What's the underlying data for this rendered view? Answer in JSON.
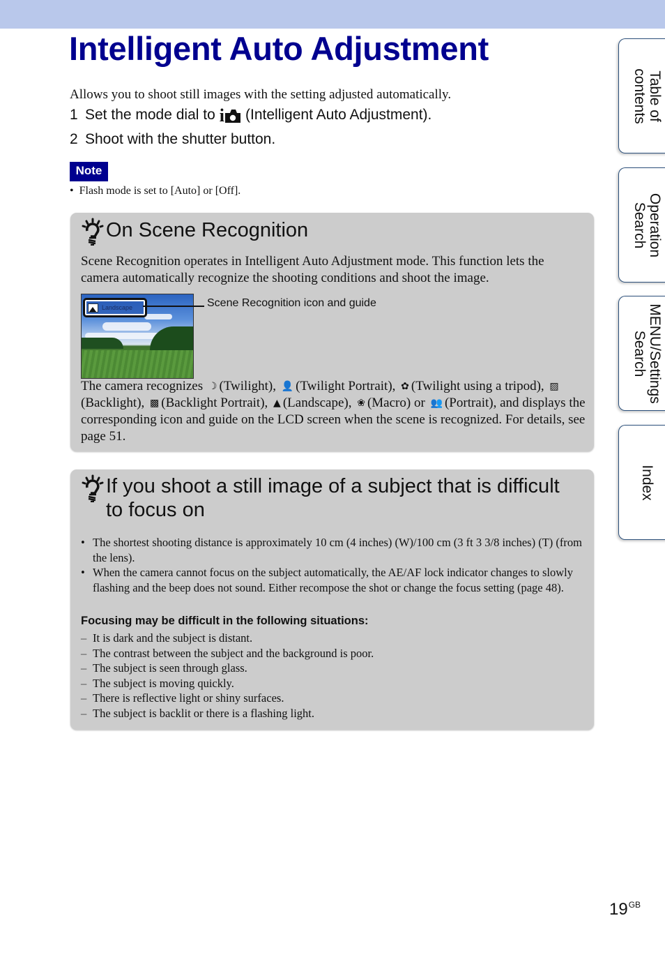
{
  "header": {
    "title": "Intelligent Auto Adjustment"
  },
  "intro": "Allows you to shoot still images with the setting adjusted automatically.",
  "steps": [
    {
      "num": "1",
      "before": "Set the mode dial to",
      "icon": "intelligent-auto-icon",
      "icon_text": "i",
      "after": "(Intelligent Auto Adjustment)."
    },
    {
      "num": "2",
      "text": "Shoot with the shutter button."
    }
  ],
  "note": {
    "label": "Note",
    "items": [
      "Flash mode is set to [Auto] or [Off]."
    ]
  },
  "panel_scene": {
    "icon": "hint-bulb-icon",
    "heading": "On Scene Recognition",
    "body": "Scene Recognition operates in Intelligent Auto Adjustment mode. This function lets the camera automatically recognize the shooting conditions and shoot the image.",
    "image_guide_label": "Landscape",
    "caption": "Scene Recognition icon and guide",
    "recognizes_prefix": "The camera recognizes",
    "scenes": [
      {
        "icon": "twilight-icon",
        "glyph": "☽",
        "label": "(Twilight),"
      },
      {
        "icon": "twilight-portrait-icon",
        "glyph": "👤",
        "label": "(Twilight Portrait),"
      },
      {
        "icon": "twilight-tripod-icon",
        "glyph": "✿",
        "label": "(Twilight using a tripod),"
      },
      {
        "icon": "backlight-icon",
        "glyph": "▨",
        "label": "(Backlight),"
      },
      {
        "icon": "backlight-portrait-icon",
        "glyph": "▩",
        "label": "(Backlight Portrait),"
      },
      {
        "icon": "landscape-icon",
        "glyph": "▲",
        "label": "(Landscape),"
      },
      {
        "icon": "macro-icon",
        "glyph": "❀",
        "label": "(Macro) or"
      },
      {
        "icon": "portrait-icon",
        "glyph": "👥",
        "label": "(Portrait), and"
      }
    ],
    "recognizes_suffix": "displays the corresponding icon and guide on the LCD screen when the scene is recognized. For details, see page 51."
  },
  "panel_focus": {
    "icon": "hint-bulb-icon",
    "heading_line1": "If you shoot a still image of a subject that is difficult",
    "heading_line2": "to focus on",
    "bullets": [
      "The shortest shooting distance is approximately 10 cm (4 inches) (W)/100 cm (3 ft 3 3/8 inches) (T) (from the lens).",
      "When the camera cannot focus on the subject automatically, the AE/AF lock indicator changes to slowly flashing and the beep does not sound. Either recompose the shot or change the focus setting (page 48)."
    ],
    "subheading": "Focusing may be difficult in the following situations:",
    "situations": [
      "It is dark and the subject is distant.",
      "The contrast between the subject and the background is poor.",
      "The subject is seen through glass.",
      "The subject is moving quickly.",
      "There is reflective light or shiny surfaces.",
      "The subject is backlit or there is a flashing light."
    ]
  },
  "side_tabs": [
    {
      "line1": "Table of",
      "line2": "contents"
    },
    {
      "line1": "Operation",
      "line2": "Search"
    },
    {
      "line1": "MENU/Settings",
      "line2": "Search"
    },
    {
      "line1": "Index",
      "line2": ""
    }
  ],
  "page": {
    "number": "19",
    "suffix": "GB"
  },
  "colors": {
    "title": "#00008f",
    "topbar": "#b9c8eb",
    "panel": "#cccccc",
    "tab_border": "#2b4f7a"
  }
}
